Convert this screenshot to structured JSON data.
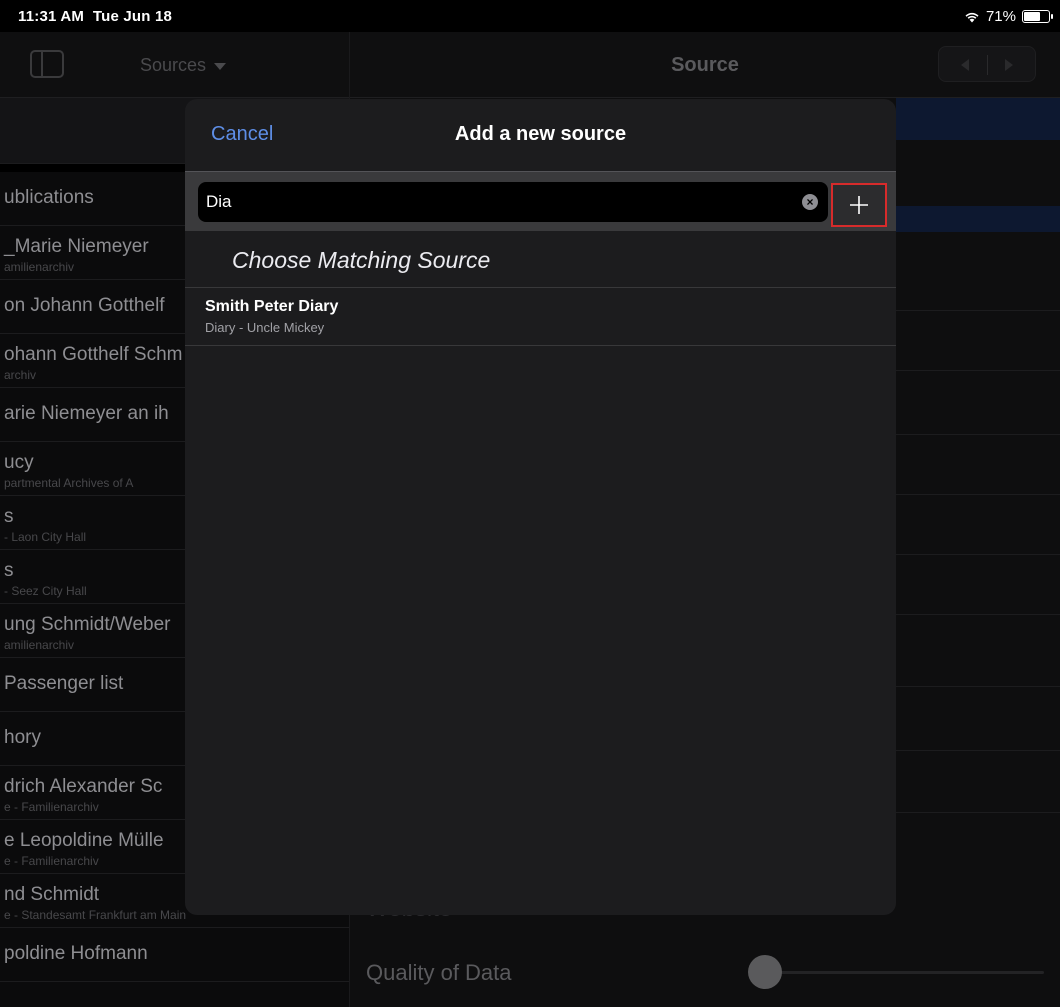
{
  "status": {
    "time": "11:31 AM",
    "date": "Tue Jun 18",
    "battery": "71%",
    "battery_level": 0.71
  },
  "sidebar": {
    "title": "Sources",
    "items": [
      {
        "title": "ublications",
        "subtitle": ""
      },
      {
        "title": "_Marie Niemeyer",
        "subtitle": "amilienarchiv"
      },
      {
        "title": "on Johann Gotthelf",
        "subtitle": ""
      },
      {
        "title": "ohann Gotthelf Schm",
        "subtitle": "archiv"
      },
      {
        "title": "arie Niemeyer an ih",
        "subtitle": ""
      },
      {
        "title": "ucy",
        "subtitle": "partmental Archives of A"
      },
      {
        "title": "s",
        "subtitle": " - Laon City Hall"
      },
      {
        "title": "s",
        "subtitle": " - Seez City Hall"
      },
      {
        "title": "ung Schmidt/Weber",
        "subtitle": "amilienarchiv"
      },
      {
        "title": "Passenger list",
        "subtitle": ""
      },
      {
        "title": "hory",
        "subtitle": ""
      },
      {
        "title": "drich Alexander Sc",
        "subtitle": "e - Familienarchiv"
      },
      {
        "title": "e Leopoldine Mülle",
        "subtitle": "e - Familienarchiv"
      },
      {
        "title": "nd Schmidt",
        "subtitle": "e - Standesamt Frankfurt am Main"
      },
      {
        "title": "poldine Hofmann",
        "subtitle": ""
      }
    ]
  },
  "detail": {
    "title": "Source",
    "website_label": "Website",
    "quality_label": "Quality of Data",
    "quality_value": 0
  },
  "modal": {
    "cancel_label": "Cancel",
    "title": "Add a new source",
    "search_value": "Dia",
    "section_header": "Choose Matching Source",
    "results": [
      {
        "title": "Smith Peter Diary",
        "subtitle": "Diary - Uncle Mickey"
      }
    ]
  }
}
